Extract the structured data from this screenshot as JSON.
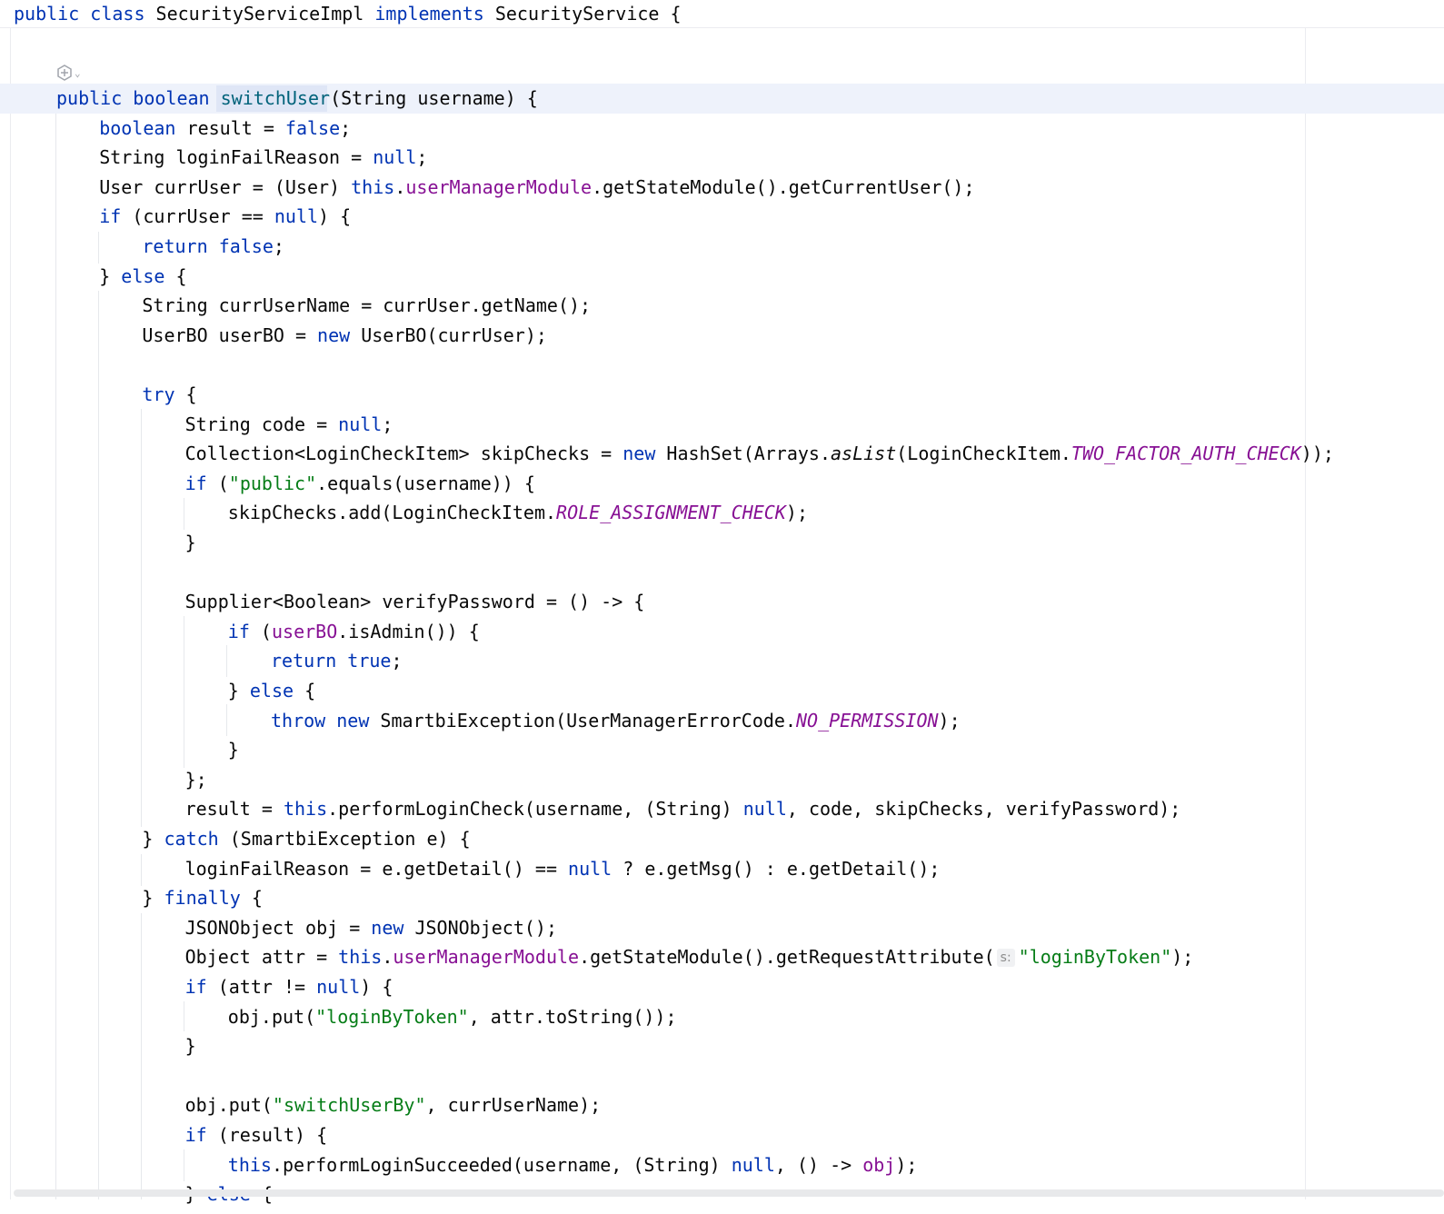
{
  "sticky_header": [
    {
      "t": "public",
      "c": "kw"
    },
    {
      "t": " "
    },
    {
      "t": "class",
      "c": "kw"
    },
    {
      "t": " SecurityServiceImpl "
    },
    {
      "t": "implements",
      "c": "kw"
    },
    {
      "t": " SecurityService {"
    }
  ],
  "ai_icon": "ai-assistant-icon",
  "code_lines": [
    {
      "indent": 1,
      "tokens": [
        {
          "t": "public",
          "c": "kw"
        },
        {
          "t": " "
        },
        {
          "t": "boolean",
          "c": "kw"
        },
        {
          "t": " "
        },
        {
          "t": "switchUser",
          "c": "fn"
        },
        {
          "t": "(String username) {"
        }
      ]
    },
    {
      "indent": 2,
      "tokens": [
        {
          "t": "boolean",
          "c": "kw"
        },
        {
          "t": " result = "
        },
        {
          "t": "false",
          "c": "kw"
        },
        {
          "t": ";"
        }
      ]
    },
    {
      "indent": 2,
      "tokens": [
        {
          "t": "String loginFailReason = "
        },
        {
          "t": "null",
          "c": "kw"
        },
        {
          "t": ";"
        }
      ]
    },
    {
      "indent": 2,
      "tokens": [
        {
          "t": "User currUser = (User) "
        },
        {
          "t": "this",
          "c": "kw"
        },
        {
          "t": "."
        },
        {
          "t": "userManagerModule",
          "c": "fld"
        },
        {
          "t": ".getStateModule().getCurrentUser();"
        }
      ]
    },
    {
      "indent": 2,
      "tokens": [
        {
          "t": "if",
          "c": "kw"
        },
        {
          "t": " (currUser == "
        },
        {
          "t": "null",
          "c": "kw"
        },
        {
          "t": ") {"
        }
      ]
    },
    {
      "indent": 3,
      "tokens": [
        {
          "t": "return",
          "c": "kw"
        },
        {
          "t": " "
        },
        {
          "t": "false",
          "c": "kw"
        },
        {
          "t": ";"
        }
      ]
    },
    {
      "indent": 2,
      "tokens": [
        {
          "t": "} "
        },
        {
          "t": "else",
          "c": "kw"
        },
        {
          "t": " {"
        }
      ]
    },
    {
      "indent": 3,
      "tokens": [
        {
          "t": "String currUserName = currUser.getName();"
        }
      ]
    },
    {
      "indent": 3,
      "tokens": [
        {
          "t": "UserBO userBO = "
        },
        {
          "t": "new",
          "c": "kw"
        },
        {
          "t": " UserBO(currUser);"
        }
      ]
    },
    {
      "indent": 0,
      "tokens": []
    },
    {
      "indent": 3,
      "tokens": [
        {
          "t": "try",
          "c": "kw"
        },
        {
          "t": " {"
        }
      ]
    },
    {
      "indent": 4,
      "tokens": [
        {
          "t": "String code = "
        },
        {
          "t": "null",
          "c": "kw"
        },
        {
          "t": ";"
        }
      ]
    },
    {
      "indent": 4,
      "tokens": [
        {
          "t": "Collection<LoginCheckItem> skipChecks = "
        },
        {
          "t": "new",
          "c": "kw"
        },
        {
          "t": " HashSet(Arrays."
        },
        {
          "t": "asList",
          "c": "stat"
        },
        {
          "t": "(LoginCheckItem."
        },
        {
          "t": "TWO_FACTOR_AUTH_CHECK",
          "c": "const"
        },
        {
          "t": "));"
        }
      ]
    },
    {
      "indent": 4,
      "tokens": [
        {
          "t": "if",
          "c": "kw"
        },
        {
          "t": " ("
        },
        {
          "t": "\"public\"",
          "c": "str"
        },
        {
          "t": ".equals(username)) {"
        }
      ]
    },
    {
      "indent": 5,
      "tokens": [
        {
          "t": "skipChecks.add(LoginCheckItem."
        },
        {
          "t": "ROLE_ASSIGNMENT_CHECK",
          "c": "const"
        },
        {
          "t": ");"
        }
      ]
    },
    {
      "indent": 4,
      "tokens": [
        {
          "t": "}"
        }
      ]
    },
    {
      "indent": 0,
      "tokens": []
    },
    {
      "indent": 4,
      "tokens": [
        {
          "t": "Supplier<Boolean> verifyPassword = () -> {"
        }
      ]
    },
    {
      "indent": 5,
      "tokens": [
        {
          "t": "if",
          "c": "kw"
        },
        {
          "t": " ("
        },
        {
          "t": "userBO",
          "c": "fld"
        },
        {
          "t": ".isAdmin()) {"
        }
      ]
    },
    {
      "indent": 6,
      "tokens": [
        {
          "t": "return",
          "c": "kw"
        },
        {
          "t": " "
        },
        {
          "t": "true",
          "c": "kw"
        },
        {
          "t": ";"
        }
      ]
    },
    {
      "indent": 5,
      "tokens": [
        {
          "t": "} "
        },
        {
          "t": "else",
          "c": "kw"
        },
        {
          "t": " {"
        }
      ]
    },
    {
      "indent": 6,
      "tokens": [
        {
          "t": "throw",
          "c": "kw"
        },
        {
          "t": " "
        },
        {
          "t": "new",
          "c": "kw"
        },
        {
          "t": " SmartbiException(UserManagerErrorCode."
        },
        {
          "t": "NO_PERMISSION",
          "c": "const"
        },
        {
          "t": ");"
        }
      ]
    },
    {
      "indent": 5,
      "tokens": [
        {
          "t": "}"
        }
      ]
    },
    {
      "indent": 4,
      "tokens": [
        {
          "t": "};"
        }
      ]
    },
    {
      "indent": 4,
      "tokens": [
        {
          "t": "result = "
        },
        {
          "t": "this",
          "c": "kw"
        },
        {
          "t": ".performLoginCheck(username, (String) "
        },
        {
          "t": "null",
          "c": "kw"
        },
        {
          "t": ", code, skipChecks, verifyPassword);"
        }
      ]
    },
    {
      "indent": 3,
      "tokens": [
        {
          "t": "} "
        },
        {
          "t": "catch",
          "c": "kw"
        },
        {
          "t": " (SmartbiException e) {"
        }
      ]
    },
    {
      "indent": 4,
      "tokens": [
        {
          "t": "loginFailReason = e.getDetail() == "
        },
        {
          "t": "null",
          "c": "kw"
        },
        {
          "t": " ? e.getMsg() : e.getDetail();"
        }
      ]
    },
    {
      "indent": 3,
      "tokens": [
        {
          "t": "} "
        },
        {
          "t": "finally",
          "c": "kw"
        },
        {
          "t": " {"
        }
      ]
    },
    {
      "indent": 4,
      "tokens": [
        {
          "t": "JSONObject obj = "
        },
        {
          "t": "new",
          "c": "kw"
        },
        {
          "t": " JSONObject();"
        }
      ]
    },
    {
      "indent": 4,
      "tokens": [
        {
          "t": "Object attr = "
        },
        {
          "t": "this",
          "c": "kw"
        },
        {
          "t": "."
        },
        {
          "t": "userManagerModule",
          "c": "fld"
        },
        {
          "t": ".getStateModule().getRequestAttribute("
        },
        {
          "t": "s:",
          "c": "hint"
        },
        {
          "t": "\"loginByToken\"",
          "c": "str"
        },
        {
          "t": ");"
        }
      ]
    },
    {
      "indent": 4,
      "tokens": [
        {
          "t": "if",
          "c": "kw"
        },
        {
          "t": " (attr != "
        },
        {
          "t": "null",
          "c": "kw"
        },
        {
          "t": ") {"
        }
      ]
    },
    {
      "indent": 5,
      "tokens": [
        {
          "t": "obj.put("
        },
        {
          "t": "\"loginByToken\"",
          "c": "str"
        },
        {
          "t": ", attr.toString());"
        }
      ]
    },
    {
      "indent": 4,
      "tokens": [
        {
          "t": "}"
        }
      ]
    },
    {
      "indent": 0,
      "tokens": []
    },
    {
      "indent": 4,
      "tokens": [
        {
          "t": "obj.put("
        },
        {
          "t": "\"switchUserBy\"",
          "c": "str"
        },
        {
          "t": ", currUserName);"
        }
      ]
    },
    {
      "indent": 4,
      "tokens": [
        {
          "t": "if",
          "c": "kw"
        },
        {
          "t": " (result) {"
        }
      ]
    },
    {
      "indent": 5,
      "tokens": [
        {
          "t": "this",
          "c": "kw"
        },
        {
          "t": ".performLoginSucceeded(username, (String) "
        },
        {
          "t": "null",
          "c": "kw"
        },
        {
          "t": ", () -> "
        },
        {
          "t": "obj",
          "c": "fld"
        },
        {
          "t": ");"
        }
      ]
    },
    {
      "indent": 4,
      "tokens": [
        {
          "t": "} "
        },
        {
          "t": "else",
          "c": "kw"
        },
        {
          "t": " {"
        }
      ]
    }
  ]
}
